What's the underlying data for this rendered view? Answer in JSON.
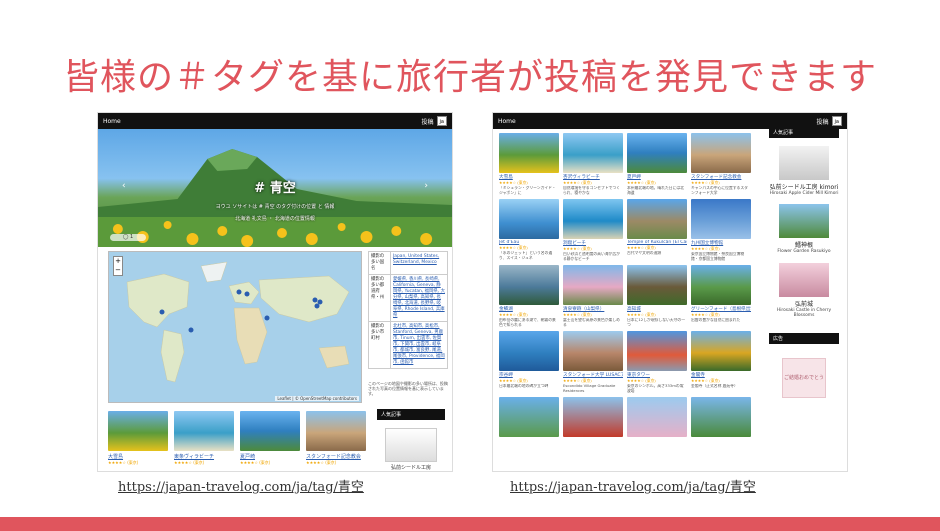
{
  "headline": "皆様の＃タグを基に旅行者が投稿を発見できます",
  "colors": {
    "accent": "#e0555d",
    "topbar": "#111111",
    "link": "#2a5db0",
    "stars": "#f0a500"
  },
  "left_shot": {
    "url": "https://japan-travelog.com/ja/tag/青空",
    "topbar": {
      "home": "Home",
      "post": "投稿",
      "lang": "ja"
    },
    "hero": {
      "title": "# 青空",
      "subtitle": "ヨウユ ソサイトは # 青空 のタグ付けの位置 と 情報",
      "subtitle2": "北海道 礼文島 ・ 北海道の位置情報",
      "prev": "‹",
      "next": "›",
      "pill": "◯ 1"
    },
    "map": {
      "zoom_in": "+",
      "zoom_out": "−",
      "attribution": "Leaflet | © OpenStreetMap contributors"
    },
    "info": [
      {
        "k": "撮影の多い国名",
        "v": "Japan, United States, Switzerland, Mexico"
      },
      {
        "k": "撮影の多い都道府県・州",
        "v": "愛媛県, 香川県, 長崎県, California, Geneva, 静岡県, Yucatan, 福岡県, 大分県, 山梨県, 高知県, 長崎県, 北海道, 長野県, 岐阜県, Rhode Island, 兵庫県"
      },
      {
        "k": "撮影の多い市町村",
        "v": "北杜市, 高知市, 高松市, Stanford, Geneva, 男鹿市, Tinum, 出雲市, 佐賀市, 下関市, 出雲市, 岐阜市, 都城市, 富良野, 尾道, 尾張市, Providence, 福岡市, 函館市"
      }
    ],
    "map_note": "このページの地図や撮影の多い場所は、投稿された写真の位置情報を基に表示しています。",
    "thumbs": [
      {
        "title": "大雪島",
        "stars": "★★★★☆ (東京)",
        "desc": "（ ）"
      },
      {
        "title": "東条ヴィラビーチ",
        "stars": "★★★★☆ (東京)",
        "desc": "（ ）"
      },
      {
        "title": "夏戸崎",
        "stars": "★★★★☆ (東京)",
        "desc": "（ ）"
      },
      {
        "title": "スタンフォード記念教会",
        "stars": "★★★★☆ (東京)",
        "desc": "（ ）"
      }
    ],
    "side": {
      "header": "人気記事",
      "caption": "弘前シードル工房"
    }
  },
  "right_shot": {
    "url": "https://japan-travelog.com/ja/tag/青空",
    "topbar": {
      "home": "Home",
      "post": "投稿",
      "lang": "ja"
    },
    "grid": [
      {
        "title": "大雪島",
        "stars": "★★★★☆ (東京)",
        "desc": "「ミシュラン・グリーンガイド・ジャポン」に"
      },
      {
        "title": "杏沢ヴィラビーチ",
        "stars": "★★★★☆ (東京)",
        "desc": "自然環境を守るコンセプトでつくられ、穏やかな"
      },
      {
        "title": "夏戸岬",
        "stars": "★★★★☆ (東京)",
        "desc": "本州最北端の地。晴れた日には北海道"
      },
      {
        "title": "スタンフォード記念教会",
        "stars": "★★★★☆ (東京)",
        "desc": "キャンパスの中心に位置するスタンフォード大学"
      },
      {
        "title": "Jet d'Eau",
        "stars": "★★★★☆ (東京)",
        "desc": "「水のジェット」という名の通り、スイス・ジュネ"
      },
      {
        "title": "洞窟ビーチ",
        "stars": "★★★★☆ (東京)",
        "desc": "白い砂浜と透明度の高い海が広がる静かなビーチ"
      },
      {
        "title": "Temple of Kukulcán (El Castillo)",
        "stars": "★★★★☆ (東京)",
        "desc": "古代マヤ文明の遺跡"
      },
      {
        "title": "九州国立博物館",
        "stars": "★★★★☆ (東京)",
        "desc": "東京国立博物館・奈良国立博物館・京都国立博物館"
      },
      {
        "title": "金鱗湖",
        "stars": "★★★★☆ (東京)",
        "desc": "由布岳の麓にある湖で、朝霧の景色で知られる"
      },
      {
        "title": "清泉寮跡（山梨県）",
        "stars": "★★★★☆ (東京)",
        "desc": "富士山を望む高原の景色が楽しめる"
      },
      {
        "title": "高知城",
        "stars": "★★★★☆ (東京)",
        "desc": "日本に12しか現存しない天守の一つ"
      },
      {
        "title": "グリーンフォード（島根県出雲市）",
        "stars": "★★★★☆ (東京)",
        "desc": "出雲の豊かな自然に囲まれた"
      },
      {
        "title": "宗谷岬",
        "stars": "★★★★☆ (東京)",
        "desc": "日本最北端の地の碑が立つ岬"
      },
      {
        "title": "スタンフォード大学 LUSACアパートメント",
        "stars": "★★★★☆ (東京)",
        "desc": "Escondido Village Graduate Residences"
      },
      {
        "title": "東京タワー",
        "stars": "★★★★☆ (東京)",
        "desc": "東京のシンボル。高さ333mの電波塔"
      },
      {
        "title": "金閣寺",
        "stars": "★★★★☆ (東京)",
        "desc": "金閣寺（正式名称 鹿苑寺）"
      },
      {
        "title": "",
        "stars": "",
        "desc": ""
      },
      {
        "title": "",
        "stars": "",
        "desc": ""
      },
      {
        "title": "",
        "stars": "",
        "desc": ""
      },
      {
        "title": "",
        "stars": "",
        "desc": ""
      }
    ],
    "side": {
      "header": "人気記事",
      "items": [
        {
          "name": "弘前シードル工房 kimori",
          "en": "Hirosaki Apple Cider Mill Kimori"
        },
        {
          "name": "鱈神根",
          "en": "Flower Garden Rasukiyo"
        },
        {
          "name": "弘前城",
          "en": "Hirosaki Castle in Cherry Blossoms"
        }
      ],
      "ad_header": "広告",
      "ad_text": "ご結婚おめでとう"
    }
  }
}
